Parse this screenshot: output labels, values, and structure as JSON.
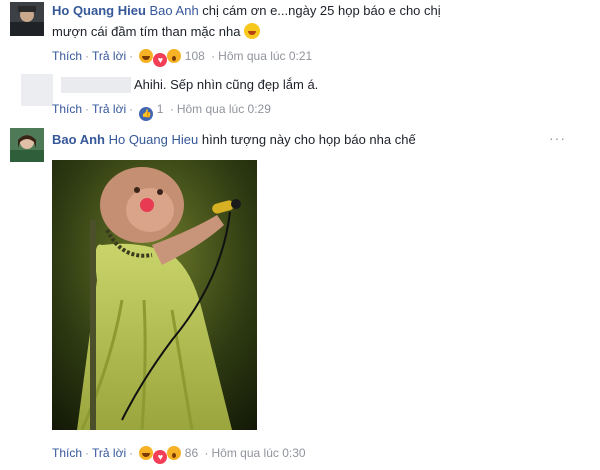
{
  "comments": [
    {
      "author": "Ho Quang Hieu",
      "tag": "Bao Anh",
      "text_line1": "chị cám ơn e...ngày 25 họp báo e cho chị",
      "text_line2": "mượn cái đầm tím than mặc nha",
      "emoji": "grinning-face-with-tongue",
      "actions": {
        "like": "Thích",
        "reply": "Trả lời",
        "reactions_count": "108",
        "time": "Hôm qua lúc 0:21"
      }
    },
    {
      "author": "",
      "text": "Ahihi. Sếp nhìn cũng đẹp lắm á.",
      "actions": {
        "like": "Thích",
        "reply": "Trả lời",
        "reactions_count": "1",
        "time": "Hôm qua lúc 0:29"
      }
    },
    {
      "author": "Bao Anh",
      "tag": "Ho Quang Hieu",
      "text": "hình tượng này cho họp báo nha chế",
      "image": "monkey-in-green-dress-singing-photo",
      "actions": {
        "like": "Thích",
        "reply": "Trả lời",
        "reactions_count": "86",
        "time": "Hôm qua lúc 0:30"
      }
    }
  ],
  "icons": {
    "more": "more-options-icon",
    "haha": "haha-reaction-icon",
    "wow": "wow-reaction-icon",
    "love": "love-reaction-icon",
    "like": "like-reaction-icon"
  },
  "colors": {
    "link": "#365899",
    "meta": "#90949c",
    "haha": "#f7b125",
    "love": "#f33e58",
    "like": "#4267b2"
  }
}
